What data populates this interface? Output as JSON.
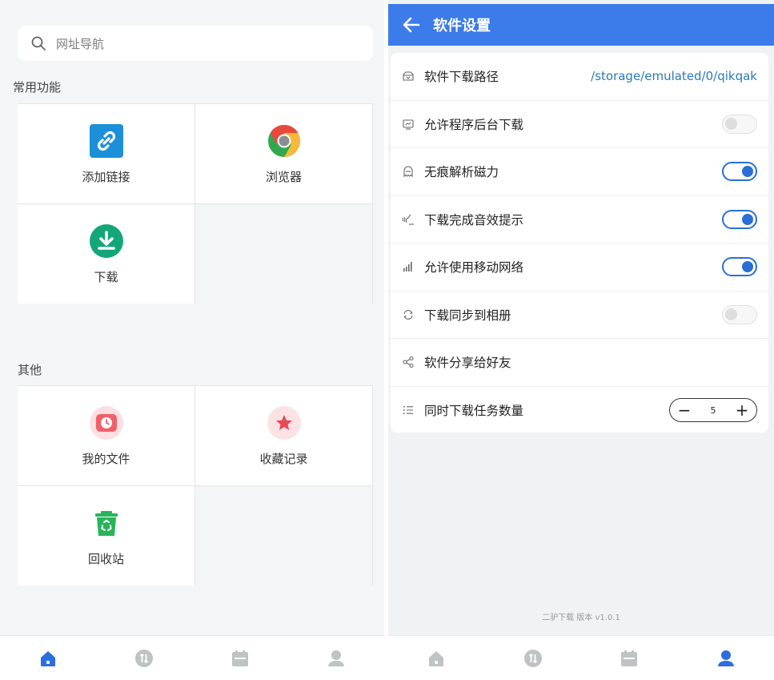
{
  "left": {
    "search": {
      "placeholder": "网址导航",
      "icon": "search-icon"
    },
    "sections": [
      {
        "title": "常用功能",
        "items": [
          {
            "label": "添加链接",
            "icon": "link-icon",
            "color": "#1b8fd8"
          },
          {
            "label": "浏览器",
            "icon": "chrome-browser-icon",
            "color": "#e9493b"
          },
          {
            "label": "下载",
            "icon": "download-icon",
            "color": "#13a67a"
          }
        ]
      },
      {
        "title": "其他",
        "items": [
          {
            "label": "我的文件",
            "icon": "clock-folder-icon",
            "color": "#f0606a"
          },
          {
            "label": "收藏记录",
            "icon": "star-icon",
            "color": "#e84a5a"
          },
          {
            "label": "回收站",
            "icon": "recycle-bin-icon",
            "color": "#28b45a"
          }
        ]
      }
    ],
    "tabbar": {
      "items": [
        {
          "icon": "home-icon",
          "active": true
        },
        {
          "icon": "transfer-icon",
          "active": false
        },
        {
          "icon": "calendar-icon",
          "active": false
        },
        {
          "icon": "user-icon",
          "active": false
        }
      ]
    }
  },
  "right": {
    "appbar": {
      "title": "软件设置",
      "back_icon": "back-arrow-icon"
    },
    "settings": [
      {
        "label": "软件下载路径",
        "icon": "folder-icon",
        "value": "/storage/emulated/0/qikqak",
        "control": "path"
      },
      {
        "label": "允许程序后台下载",
        "icon": "monitor-icon",
        "control": "toggle",
        "on": false
      },
      {
        "label": "无痕解析磁力",
        "icon": "ghost-icon",
        "control": "toggle",
        "on": true
      },
      {
        "label": "下载完成音效提示",
        "icon": "sound-icon",
        "control": "toggle",
        "on": true
      },
      {
        "label": "允许使用移动网络",
        "icon": "signal-icon",
        "control": "toggle",
        "on": true
      },
      {
        "label": "下载同步到相册",
        "icon": "sync-icon",
        "control": "toggle",
        "on": false
      },
      {
        "label": "软件分享给好友",
        "icon": "share-icon",
        "control": "none"
      },
      {
        "label": "同时下载任务数量",
        "icon": "list-icon",
        "control": "stepper",
        "value": "5",
        "minus": "−",
        "plus": "+"
      }
    ],
    "version": "二驴下载 版本 v1.0.1",
    "tabbar": {
      "items": [
        {
          "icon": "home-icon",
          "active": false
        },
        {
          "icon": "transfer-icon",
          "active": false
        },
        {
          "icon": "calendar-icon",
          "active": false
        },
        {
          "icon": "user-icon",
          "active": true
        }
      ]
    }
  },
  "colors": {
    "accent": "#3b7bea",
    "toggle_on": "#2b6fd6",
    "tab_active": "#2c6de0",
    "tab_inactive": "#bfc3c3"
  }
}
